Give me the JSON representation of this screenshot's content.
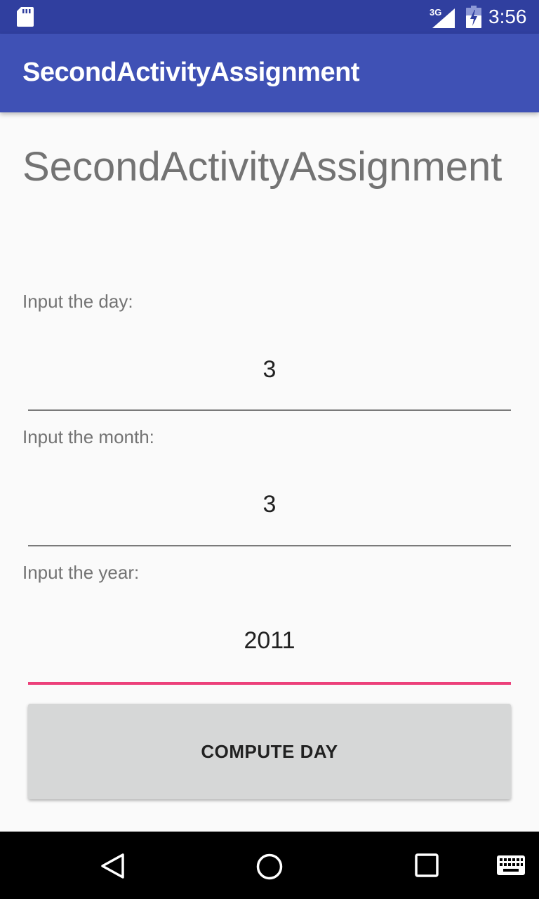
{
  "status_bar": {
    "network": "3G",
    "time": "3:56",
    "icons": [
      "sd-card-icon",
      "signal-icon",
      "battery-icon"
    ]
  },
  "app_bar": {
    "title": "SecondActivityAssignment",
    "color": "#3f51b5"
  },
  "main": {
    "heading": "SecondActivityAssignment",
    "fields": [
      {
        "label": "Input the day:",
        "value": "3"
      },
      {
        "label": "Input the month:",
        "value": "3"
      },
      {
        "label": "Input the year:",
        "value": "2011"
      }
    ],
    "focused_field": "year",
    "accent_color": "#ec407a",
    "button_label": "COMPUTE DAY"
  },
  "nav_bar": {
    "icons": [
      "back-icon",
      "home-icon",
      "recents-icon",
      "keyboard-icon"
    ]
  }
}
